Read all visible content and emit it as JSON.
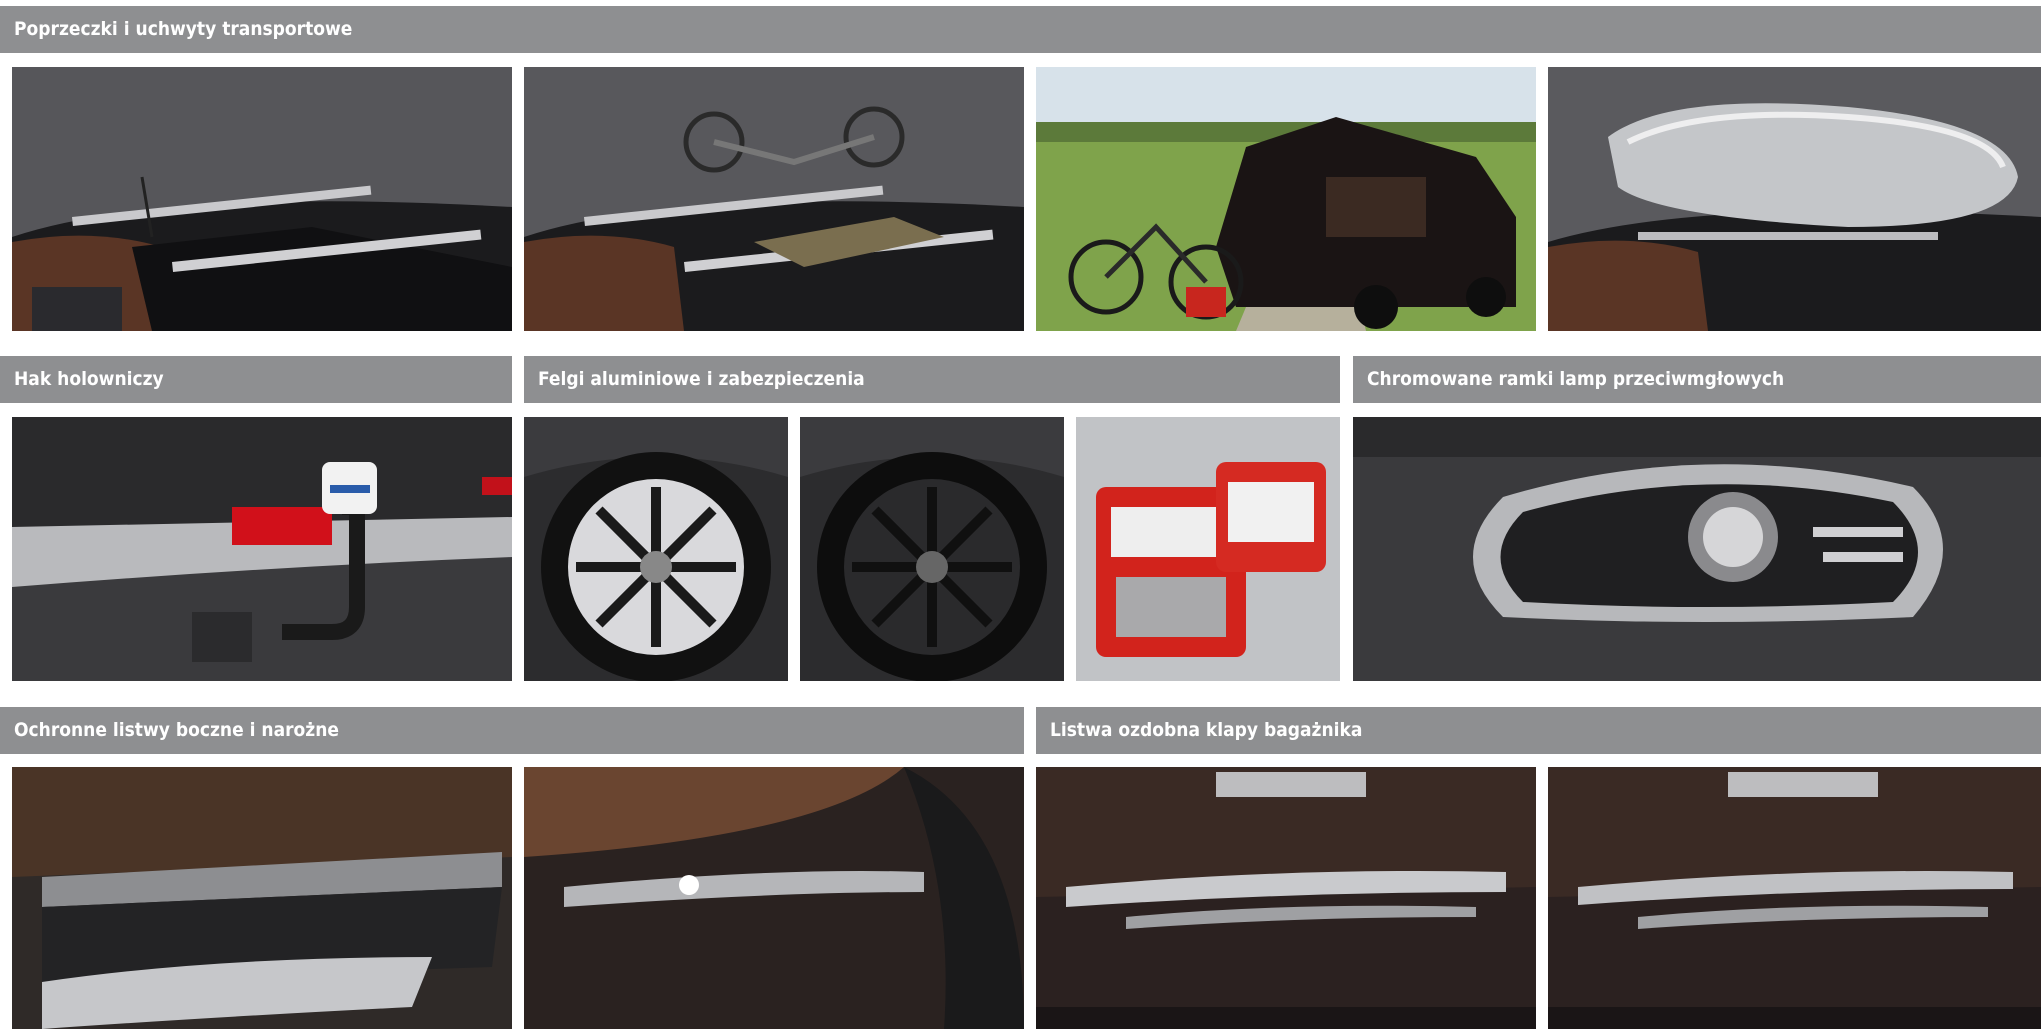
{
  "sections": {
    "roof_carriers": {
      "title": "Poprzeczki i uchwyty transportowe"
    },
    "tow_hook": {
      "title": "Hak holowniczy"
    },
    "alloy_wheels": {
      "title": "Felgi aluminiowe i zabezpieczenia"
    },
    "fog_lamp_frames": {
      "title": "Chromowane ramki lamp przeciwmgłowych"
    },
    "side_mouldings": {
      "title": "Ochronne listwy boczne i narożne"
    },
    "tailgate_trim": {
      "title": "Listwa ozdobna klapy bagażnika"
    }
  },
  "colors": {
    "header_band": "#8e8f91",
    "header_text": "#ffffff",
    "page_background": "#ffffff"
  }
}
